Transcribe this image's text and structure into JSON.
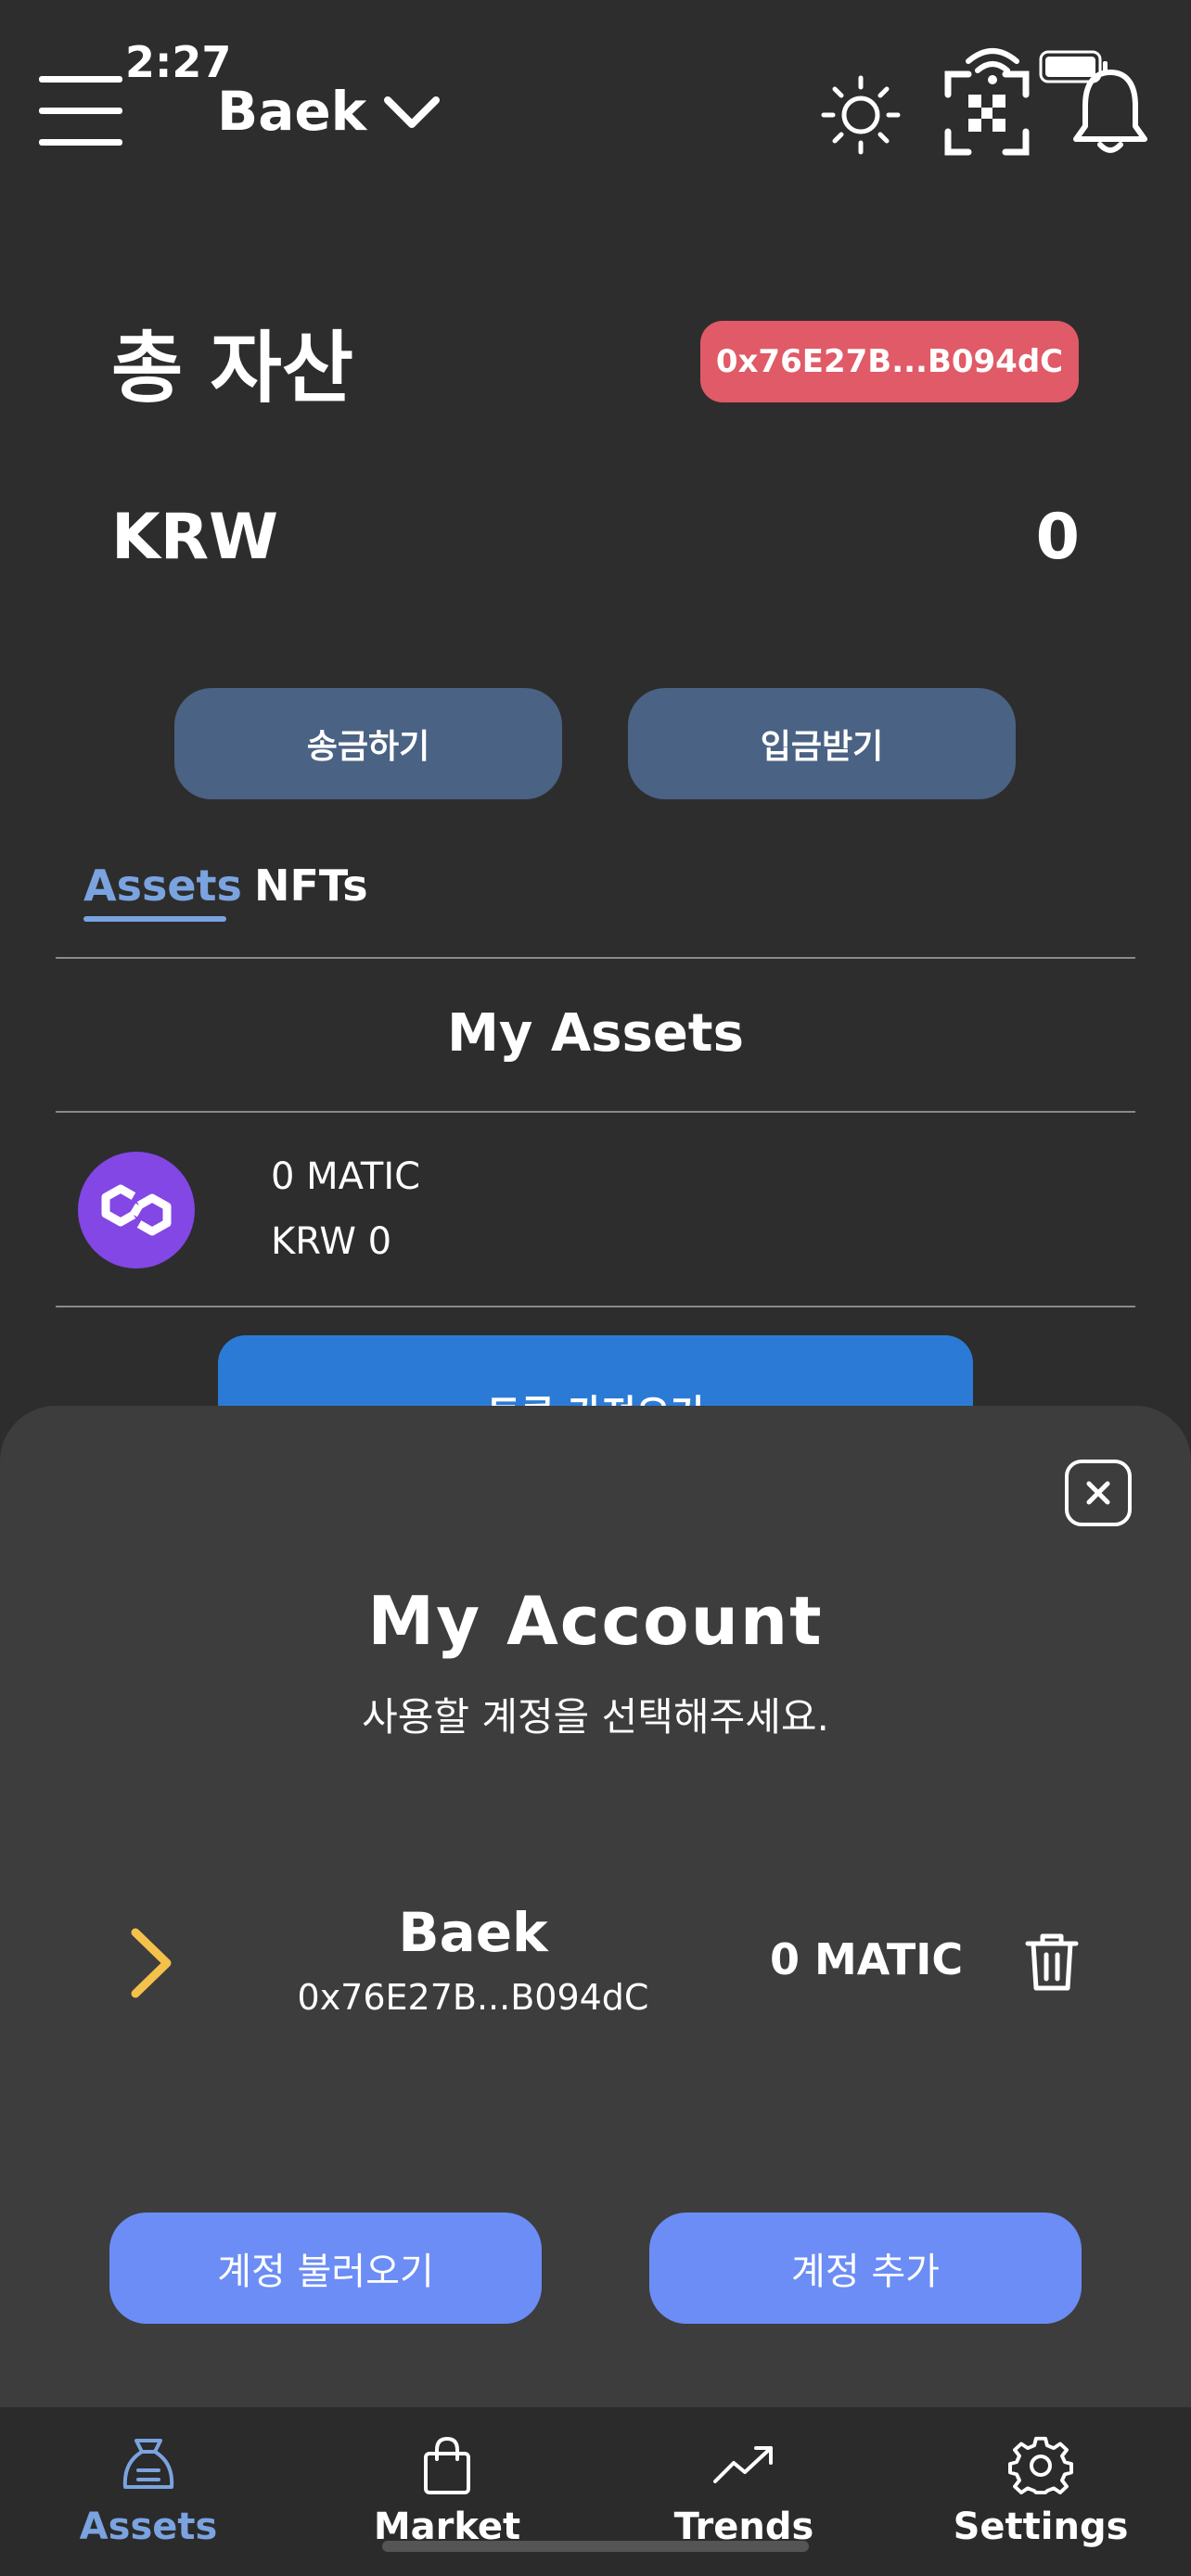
{
  "status_bar": {
    "time": "2:27"
  },
  "header": {
    "account_name": "Baek"
  },
  "summary": {
    "title": "총 자산",
    "address_short": "0x76E27B...B094dC",
    "currency": "KRW",
    "balance": "0",
    "send_label": "송금하기",
    "receive_label": "입금받기"
  },
  "tabs": [
    {
      "label": "Assets",
      "active": true
    },
    {
      "label": "NFTs",
      "active": false
    }
  ],
  "assets_section": {
    "title": "My Assets",
    "items": [
      {
        "amount": "0 MATIC",
        "fiat": "KRW 0",
        "icon": "polygon-matic-icon"
      }
    ],
    "import_token_label": "토큰 가져오기"
  },
  "account_sheet": {
    "title": "My Account",
    "subtitle": "사용할 계정을 선택해주세요.",
    "accounts": [
      {
        "name": "Baek",
        "address": "0x76E27B...B094dC",
        "balance": "0 MATIC"
      }
    ],
    "load_account_label": "계정 불러오기",
    "add_account_label": "계정 추가"
  },
  "bottom_nav": {
    "items": [
      {
        "label": "Assets",
        "icon": "assets-icon",
        "active": true
      },
      {
        "label": "Market",
        "icon": "shopping-bag-icon",
        "active": false
      },
      {
        "label": "Trends",
        "icon": "trend-up-icon",
        "active": false
      },
      {
        "label": "Settings",
        "icon": "gear-icon",
        "active": false
      }
    ]
  },
  "colors": {
    "background": "#2d2d2d",
    "sheet": "#3d3d3d",
    "address_badge": "#e05a67",
    "primary_button": "#6b8df5",
    "dark_button": "#4a6283",
    "active_tab": "#7aa3e0",
    "matic": "#8247e5",
    "chevron": "#f4c24a"
  }
}
